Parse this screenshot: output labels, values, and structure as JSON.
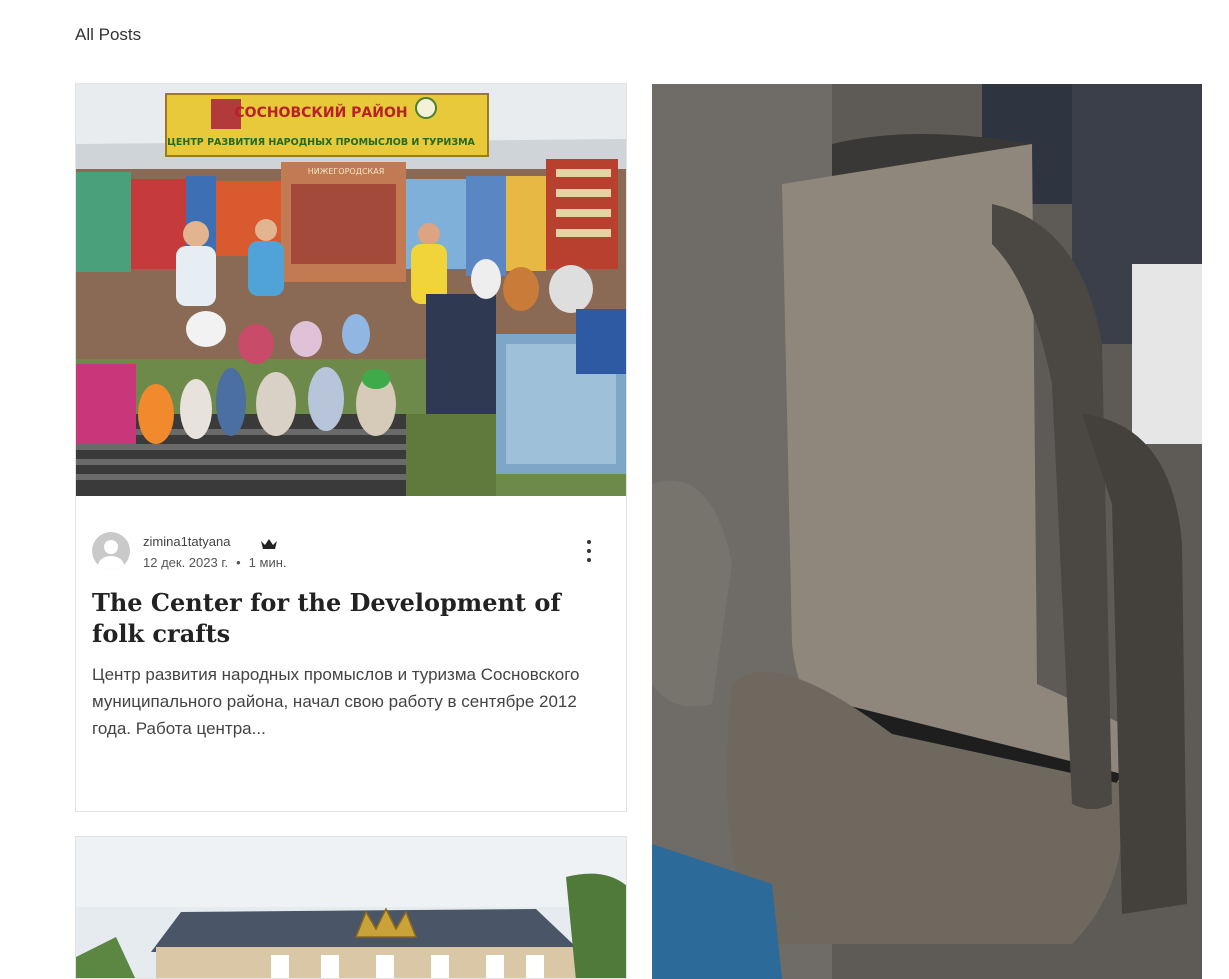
{
  "header": {
    "all_posts_label": "All Posts"
  },
  "posts": [
    {
      "author": "zimina1tatyana",
      "date": "12 дек. 2023 г.",
      "separator": "•",
      "read_time": "1 мин.",
      "title": "The Center for the Development of folk crafts",
      "excerpt": "Центр развития народных промыслов и туризма Сосновского муниципального района, начал свою работу в сентябре 2012 года. Работа центра...",
      "image": {
        "banner_line1": "СОСНОВСКИЙ РАЙОН",
        "banner_line2": "ЦЕНТР РАЗВИТИЯ НАРОДНЫХ ПРОМЫСЛОВ И ТУРИЗМА",
        "sign_text": "НИЖЕГОРОДСКАЯ"
      }
    }
  ],
  "icons": {
    "crown": "crown-icon",
    "more": "more-vertical-icon",
    "avatar": "user-avatar-icon"
  }
}
